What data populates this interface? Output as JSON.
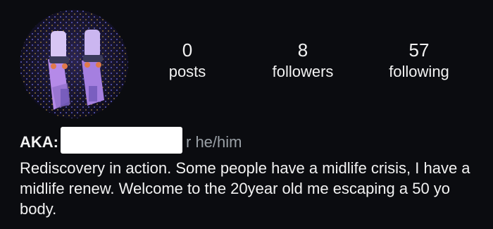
{
  "profile": {
    "stats": [
      {
        "count": "0",
        "label": "posts"
      },
      {
        "count": "8",
        "label": "followers"
      },
      {
        "count": "57",
        "label": "following"
      }
    ],
    "display_name": "AKA:",
    "pronouns": "r he/him",
    "bio": "Rediscovery in action. Some people have a midlife crisis, I have a midlife renew. Welcome to the 20year old me escaping a 50 yo body."
  },
  "colors": {
    "background": "#0b0c10",
    "text": "#f2f2f2",
    "muted_text": "#9aa0a6",
    "redaction": "#ffffff"
  },
  "icons": {
    "avatar": "profile-photo-roller-skates"
  }
}
